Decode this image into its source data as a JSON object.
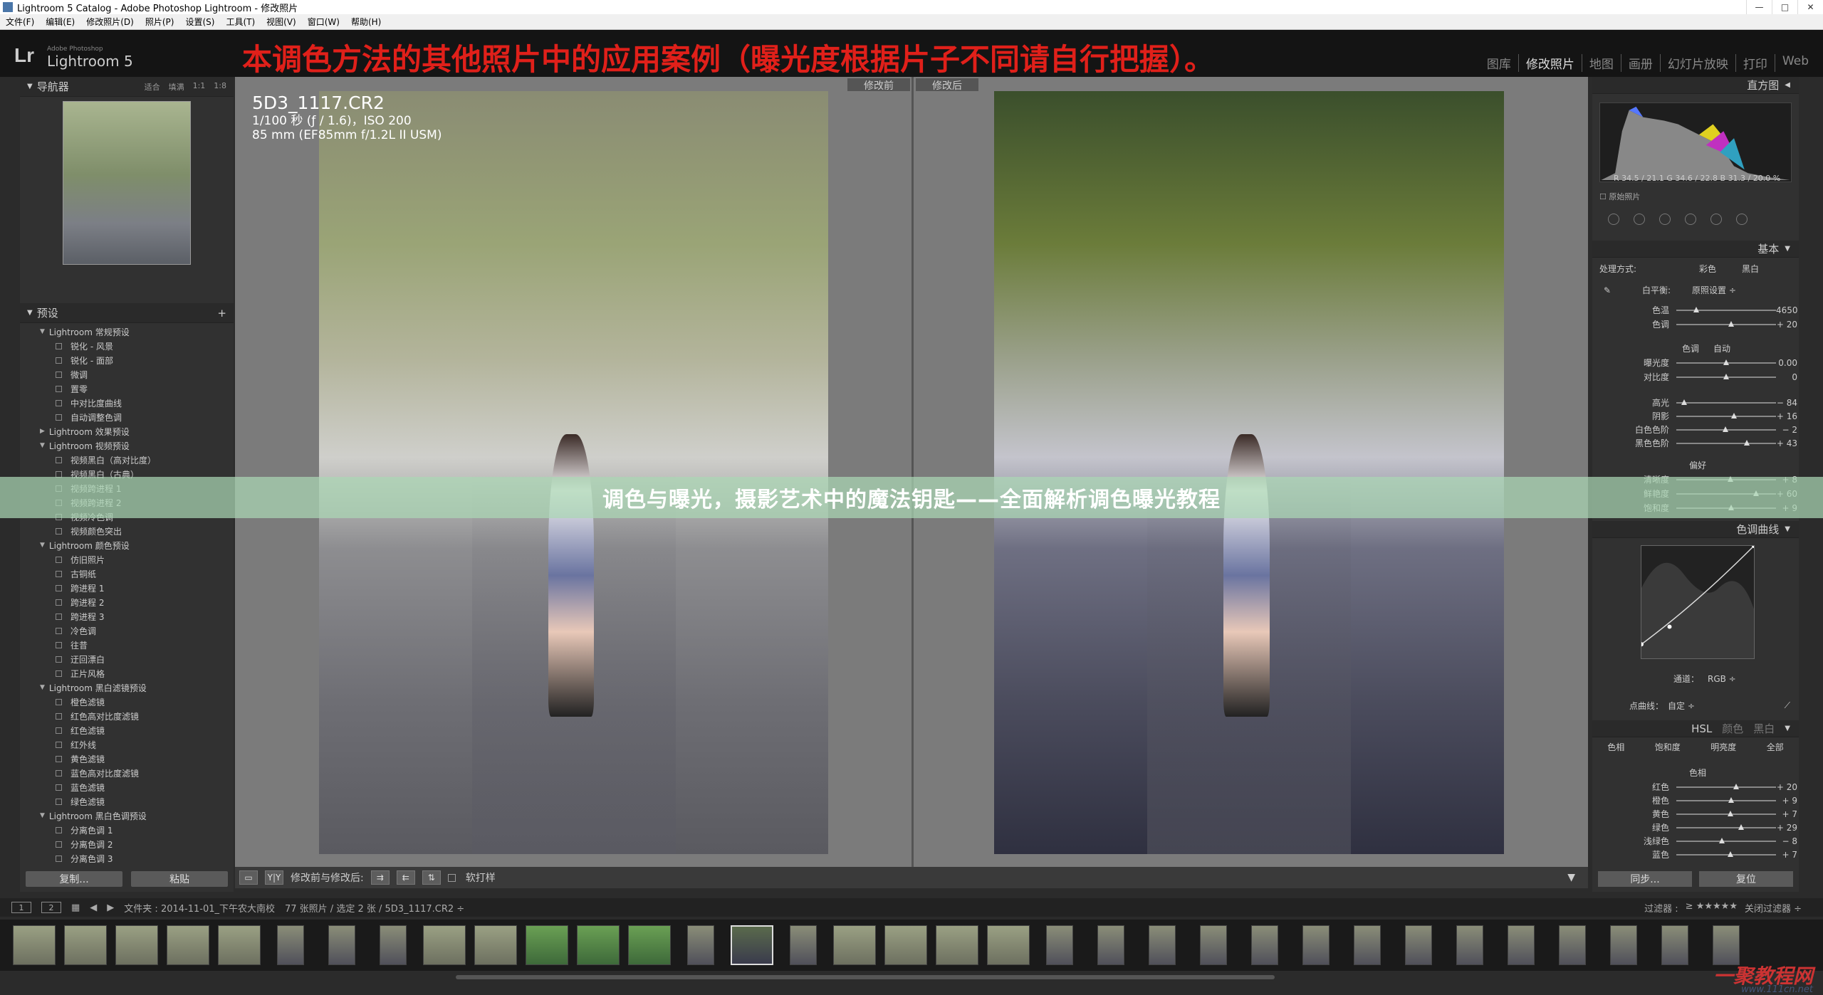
{
  "window": {
    "title": "Lightroom 5 Catalog - Adobe Photoshop Lightroom - 修改照片"
  },
  "menu": [
    "文件(F)",
    "编辑(E)",
    "修改照片(D)",
    "照片(P)",
    "设置(S)",
    "工具(T)",
    "视图(V)",
    "窗口(W)",
    "帮助(H)"
  ],
  "brand": {
    "logo": "Lr",
    "line1": "Adobe Photoshop",
    "line2": "Lightroom 5"
  },
  "banner": "本调色方法的其他照片中的应用案例（曝光度根据片子不同请自行把握）。",
  "modules": [
    "图库",
    "修改照片",
    "地图",
    "画册",
    "幻灯片放映",
    "打印",
    "Web"
  ],
  "navigator": {
    "title": "导航器",
    "opts": [
      "适合",
      "填满",
      "1:1",
      "1:8"
    ]
  },
  "presets": {
    "title": "预设",
    "items": [
      {
        "t": "Lightroom 常规预设",
        "g": true
      },
      {
        "t": "锐化 - 风景"
      },
      {
        "t": "锐化 - 面部"
      },
      {
        "t": "微调"
      },
      {
        "t": "置零"
      },
      {
        "t": "中对比度曲线"
      },
      {
        "t": "自动调整色调"
      },
      {
        "t": "Lightroom 效果预设",
        "g": true,
        "c": true
      },
      {
        "t": "Lightroom 视频预设",
        "g": true
      },
      {
        "t": "视频黑白（高对比度）"
      },
      {
        "t": "视频黑白（古典）"
      },
      {
        "t": "视频跨进程 1"
      },
      {
        "t": "视频跨进程 2"
      },
      {
        "t": "视频冷色调"
      },
      {
        "t": "视频颜色突出"
      },
      {
        "t": "Lightroom 颜色预设",
        "g": true
      },
      {
        "t": "仿旧照片"
      },
      {
        "t": "古铜纸"
      },
      {
        "t": "跨进程 1"
      },
      {
        "t": "跨进程 2"
      },
      {
        "t": "跨进程 3"
      },
      {
        "t": "冷色调"
      },
      {
        "t": "往昔"
      },
      {
        "t": "迂回漂白"
      },
      {
        "t": "正片风格"
      },
      {
        "t": "Lightroom 黑白滤镜预设",
        "g": true
      },
      {
        "t": "橙色滤镜"
      },
      {
        "t": "红色高对比度滤镜"
      },
      {
        "t": "红色滤镜"
      },
      {
        "t": "红外线"
      },
      {
        "t": "黄色滤镜"
      },
      {
        "t": "蓝色高对比度滤镜"
      },
      {
        "t": "蓝色滤镜"
      },
      {
        "t": "绿色滤镜"
      },
      {
        "t": "Lightroom 黑白色调预设",
        "g": true
      },
      {
        "t": "分离色调 1"
      },
      {
        "t": "分离色调 2"
      },
      {
        "t": "分离色调 3"
      }
    ]
  },
  "leftbuttons": {
    "copy": "复制...",
    "paste": "粘贴"
  },
  "photo": {
    "filename": "5D3_1117.CR2",
    "line2": "1/100 秒 (ƒ / 1.6)，ISO 200",
    "line3": "85 mm (EF85mm f/1.2L II USM)"
  },
  "labels": {
    "before": "修改前",
    "after": "修改后"
  },
  "toolbar": {
    "view": "Y|Y",
    "compare": "修改前与修改后:",
    "softproof": "软打样"
  },
  "right": {
    "histogram": "直方图",
    "histovals": "R  34.5 / 21.1  G  34.6 / 22.8  B  31.3 / 20.0 %",
    "orig": "原始照片",
    "basic": "基本",
    "treatment": {
      "label": "处理方式:",
      "color": "彩色",
      "bw": "黑白"
    },
    "wb": {
      "label": "白平衡:",
      "value": "原照设置 ÷"
    },
    "tone": {
      "label": "色调",
      "auto": "自动"
    },
    "presence": "偏好",
    "sliders": [
      {
        "l": "色温",
        "v": "4650",
        "p": 0.2
      },
      {
        "l": "色调",
        "v": "+ 20",
        "p": 0.55
      },
      {
        "l": "曝光度",
        "v": "0.00",
        "p": 0.5
      },
      {
        "l": "对比度",
        "v": "0",
        "p": 0.5
      },
      {
        "l": "高光",
        "v": "− 84",
        "p": 0.08
      },
      {
        "l": "阴影",
        "v": "+ 16",
        "p": 0.58
      },
      {
        "l": "白色色阶",
        "v": "− 2",
        "p": 0.49
      },
      {
        "l": "黑色色阶",
        "v": "+ 43",
        "p": 0.71
      },
      {
        "l": "清晰度",
        "v": "+ 8",
        "p": 0.54
      },
      {
        "l": "鲜艳度",
        "v": "+ 60",
        "p": 0.8
      },
      {
        "l": "饱和度",
        "v": "+ 9",
        "p": 0.55
      }
    ],
    "curve": {
      "title": "色调曲线",
      "channel": "通道：",
      "channelval": "RGB ÷",
      "point": "点曲线：",
      "pointval": "自定 ÷"
    },
    "hsl": {
      "tabs": [
        "HSL",
        "颜色",
        "黑白"
      ],
      "sub": [
        "色相",
        "饱和度",
        "明亮度",
        "全部"
      ],
      "group": "色相"
    },
    "hslsliders": [
      {
        "l": "红色",
        "v": "+ 20",
        "p": 0.6
      },
      {
        "l": "橙色",
        "v": "+ 9",
        "p": 0.55
      },
      {
        "l": "黄色",
        "v": "+ 7",
        "p": 0.54
      },
      {
        "l": "绿色",
        "v": "+ 29",
        "p": 0.65
      },
      {
        "l": "浅绿色",
        "v": "− 8",
        "p": 0.46
      },
      {
        "l": "蓝色",
        "v": "+ 7",
        "p": 0.54
      }
    ],
    "buttons": {
      "sync": "同步...",
      "reset": "复位"
    }
  },
  "filmstrip": {
    "pages": [
      "1",
      "2"
    ],
    "path": "文件夹 : 2014-11-01_下午农大南校",
    "count": "77 张照片 / 选定 2 张 / 5D3_1117.CR2 ÷",
    "filter": "过滤器 :",
    "filteroff": "关闭过滤器 ÷"
  },
  "overlay": "调色与曝光，摄影艺术中的魔法钥匙——全面解析调色曝光教程",
  "watermark": {
    "main": "一聚教程网",
    "url": "www.111cn.net"
  }
}
